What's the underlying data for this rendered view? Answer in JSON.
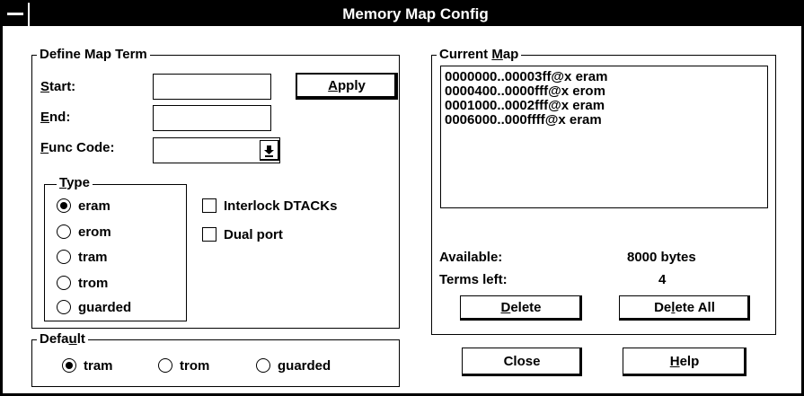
{
  "window": {
    "title": "Memory Map Config"
  },
  "define_map_term": {
    "label": "Define Map Term",
    "start": {
      "label_pre": "",
      "label_u": "S",
      "label_post": "tart:",
      "value": ""
    },
    "end": {
      "label_pre": "",
      "label_u": "E",
      "label_post": "nd:",
      "value": ""
    },
    "func_code": {
      "label_pre": "",
      "label_u": "F",
      "label_post": "unc Code:",
      "value": ""
    },
    "apply": {
      "pre": "",
      "u": "A",
      "post": "pply"
    },
    "type": {
      "label_pre": "",
      "label_u": "T",
      "label_post": "ype",
      "options": [
        "eram",
        "erom",
        "tram",
        "trom",
        "guarded"
      ],
      "selected": "eram"
    },
    "interlock_dtacks": {
      "label": "Interlock DTACKs",
      "checked": false
    },
    "dual_port": {
      "label": "Dual port",
      "checked": false
    }
  },
  "default": {
    "label_pre": "Defa",
    "label_u": "u",
    "label_post": "lt",
    "options": [
      "tram",
      "trom",
      "guarded"
    ],
    "selected": "tram"
  },
  "current_map": {
    "label_pre": "Current ",
    "label_u": "M",
    "label_post": "ap",
    "entries": [
      "0000000..00003ff@x eram",
      "0000400..0000fff@x erom",
      "0001000..0002fff@x eram",
      "0006000..000ffff@x eram"
    ],
    "available_label": "Available:",
    "available_value": "8000 bytes",
    "terms_left_label": "Terms left:",
    "terms_left_value": "4",
    "delete": {
      "pre": "",
      "u": "D",
      "post": "elete"
    },
    "delete_all": {
      "pre": "De",
      "u": "l",
      "post": "ete All"
    }
  },
  "buttons": {
    "close": {
      "pre": "Close",
      "u": "",
      "post": ""
    },
    "help": {
      "pre": "",
      "u": "H",
      "post": "elp"
    }
  }
}
